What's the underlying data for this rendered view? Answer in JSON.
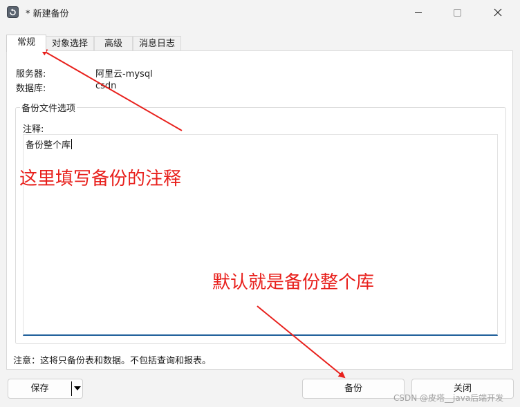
{
  "window": {
    "title": "* 新建备份",
    "controls": {
      "minimize": "minimize-icon",
      "maximize": "maximize-icon",
      "close": "close-icon"
    }
  },
  "tabs": [
    {
      "label": "常规",
      "active": true
    },
    {
      "label": "对象选择",
      "active": false
    },
    {
      "label": "高级",
      "active": false
    },
    {
      "label": "消息日志",
      "active": false
    }
  ],
  "general": {
    "server_label": "服务器:",
    "server_value": "阿里云-mysql",
    "database_label": "数据库:",
    "database_value": "csdn",
    "group_title": "备份文件选项",
    "comment_label": "注释:",
    "comment_value": "备份整个库"
  },
  "note": "注意：这将只备份表和数据。不包括查询和报表。",
  "buttons": {
    "save": "保存",
    "backup": "备份",
    "close": "关闭"
  },
  "annotations": {
    "comment_hint": "这里填写备份的注释",
    "default_hint": "默认就是备份整个库",
    "color": "#e8201c"
  },
  "watermark": "CSDN @皮塔__java后端开发",
  "colors": {
    "accent": "#1e5f9a",
    "background": "#f3f3f3"
  }
}
